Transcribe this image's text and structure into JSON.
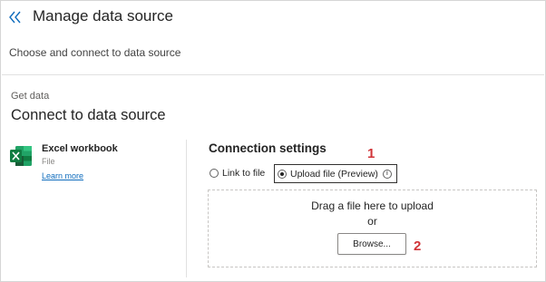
{
  "header": {
    "back_icon": "double-chevron-left-icon",
    "title": "Manage data source",
    "subtitle": "Choose and connect to data source"
  },
  "section": {
    "label": "Get data",
    "title": "Connect to data source"
  },
  "source": {
    "icon": "excel-icon",
    "name": "Excel workbook",
    "type": "File",
    "learn_more": "Learn more"
  },
  "connection": {
    "title": "Connection settings",
    "options": [
      {
        "label": "Link to file",
        "selected": false
      },
      {
        "label": "Upload file (Preview)",
        "selected": true
      }
    ],
    "info_icon": "info-icon",
    "dropzone": {
      "text": "Drag a file here to upload",
      "or": "or",
      "browse_label": "Browse..."
    }
  },
  "annotations": {
    "marker_1": "1",
    "marker_2": "2"
  },
  "colors": {
    "accent": "#0f6cbd",
    "excel_green": "#107c41",
    "annotation_red": "#d13438"
  }
}
